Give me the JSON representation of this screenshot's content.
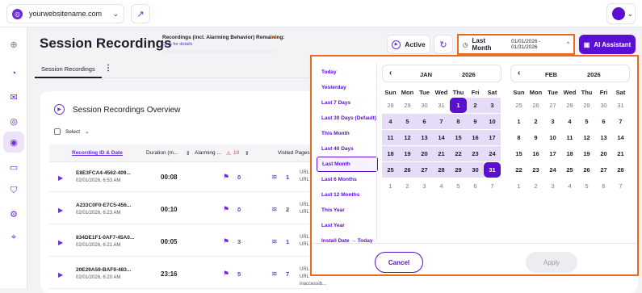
{
  "topbar": {
    "site": "yourwebsitename.com"
  },
  "sidebar": {
    "icons": [
      "home-icon",
      "pie-chart-icon",
      "inbox-icon",
      "spiral-icon",
      "recordings-icon",
      "card-icon",
      "shield-icon",
      "gear-icon",
      "map-pin-icon"
    ]
  },
  "header": {
    "title": "Session Recordings",
    "recordings_label": "Recordings (incl. Alarming Behavior) Remaining:",
    "recordings_link": "Click for details",
    "recordings_remaining_fraction": 0.0,
    "active_label": "Active",
    "date_label": "Last Month",
    "date_range": "01/01/2026 - 01/31/2026",
    "ai_label": "AI Assistant"
  },
  "tabs": {
    "active": "Session Recordings"
  },
  "overview": {
    "title": "Session Recordings Overview",
    "select_label": "Select",
    "headers": {
      "id": "Recording ID & Date",
      "duration": "Duration (m...",
      "alarming": "Alarming ...",
      "alarm_count": "10",
      "visited": "Visited Pages"
    },
    "rows": [
      {
        "id": "E8E3FCA4-4562-409...",
        "date": "02/01/2026, 6:53 AM",
        "duration": "00:08",
        "alarm": "0",
        "pages": "1",
        "url1": "URL",
        "url2": "URL"
      },
      {
        "id": "A233C0F0-E7C5-456...",
        "date": "02/01/2026, 6:23 AM",
        "duration": "00:10",
        "alarm": "0",
        "pages": "2",
        "url1": "URL",
        "url2": "URL"
      },
      {
        "id": "834DE1F1-0AF7-45A0...",
        "date": "02/01/2026, 6:21 AM",
        "duration": "00:05",
        "alarm": "3",
        "pages": "1",
        "url1": "URL",
        "url2": "URL"
      },
      {
        "id": "20E29A59-BAF9-483...",
        "date": "02/01/2026, 6:20 AM",
        "duration": "23:16",
        "alarm": "5",
        "pages": "7",
        "url1": "URL",
        "url2": "URL inaccessib..."
      }
    ]
  },
  "datepicker": {
    "presets": [
      "Today",
      "Yesterday",
      "Last 7 Days",
      "Last 30 Days (Default)",
      "This Month",
      "Last 40 Days",
      "Last Month",
      "Last 6 Months",
      "Last 12 Months",
      "This Year",
      "Last Year",
      "Install Date → Today"
    ],
    "selected_preset": "Last Month",
    "weekdays": [
      "Sun",
      "Mon",
      "Tue",
      "Wed",
      "Thu",
      "Fri",
      "Sat"
    ],
    "jan": {
      "month": "JAN",
      "year": "2026",
      "days": [
        "28",
        "29",
        "30",
        "31",
        "1",
        "2",
        "3",
        "4",
        "5",
        "6",
        "7",
        "8",
        "9",
        "10",
        "11",
        "12",
        "13",
        "14",
        "15",
        "16",
        "17",
        "18",
        "19",
        "20",
        "21",
        "22",
        "23",
        "24",
        "25",
        "26",
        "27",
        "28",
        "29",
        "30",
        "31",
        "1",
        "2",
        "3",
        "4",
        "5",
        "6",
        "7"
      ]
    },
    "feb": {
      "month": "FEB",
      "year": "2026",
      "days": [
        "25",
        "26",
        "27",
        "28",
        "29",
        "30",
        "31",
        "1",
        "2",
        "3",
        "4",
        "5",
        "6",
        "7",
        "8",
        "9",
        "10",
        "11",
        "12",
        "13",
        "14",
        "15",
        "16",
        "17",
        "18",
        "19",
        "20",
        "21",
        "22",
        "23",
        "24",
        "25",
        "26",
        "27",
        "28",
        "1",
        "2",
        "3",
        "4",
        "5",
        "6",
        "7"
      ]
    },
    "cancel": "Cancel",
    "apply": "Apply"
  }
}
